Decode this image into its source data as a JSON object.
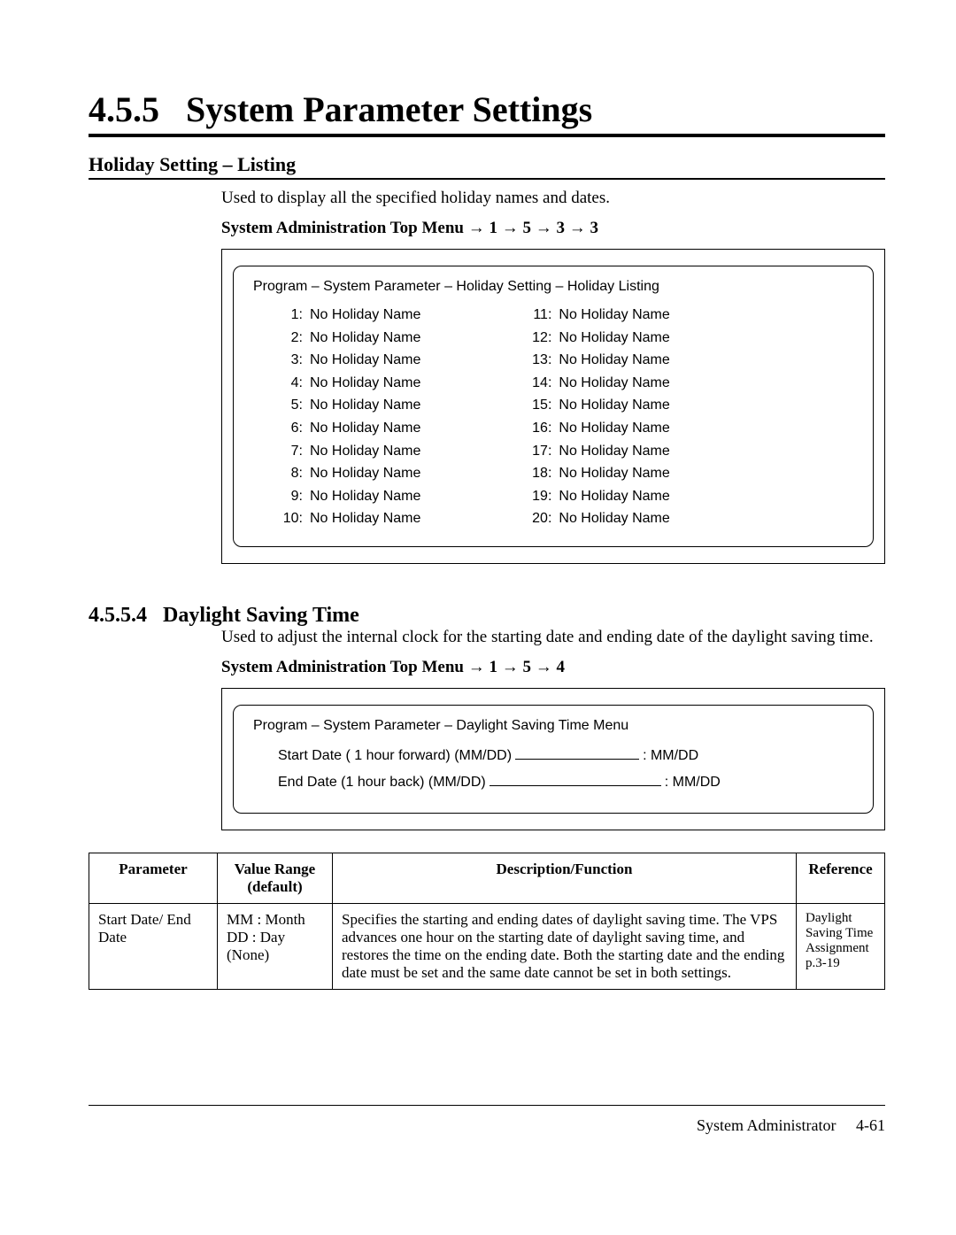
{
  "section": {
    "number": "4.5.5",
    "title": "System Parameter Settings"
  },
  "holiday_listing": {
    "heading": "Holiday Setting – Listing",
    "intro": "Used to display all the specified holiday names and dates.",
    "menu_path": "System Administration Top Menu → 1 → 5 → 3 → 3",
    "screen_title": "Program – System Parameter – Holiday Setting – Holiday Listing",
    "left": [
      {
        "n": "1:",
        "t": "No Holiday Name"
      },
      {
        "n": "2:",
        "t": "No Holiday Name"
      },
      {
        "n": "3:",
        "t": "No Holiday Name"
      },
      {
        "n": "4:",
        "t": "No Holiday Name"
      },
      {
        "n": "5:",
        "t": "No Holiday Name"
      },
      {
        "n": "6:",
        "t": "No Holiday Name"
      },
      {
        "n": "7:",
        "t": "No Holiday Name"
      },
      {
        "n": "8:",
        "t": "No Holiday Name"
      },
      {
        "n": "9:",
        "t": "No Holiday Name"
      },
      {
        "n": "10:",
        "t": "No Holiday Name"
      }
    ],
    "right": [
      {
        "n": "11:",
        "t": "No Holiday Name"
      },
      {
        "n": "12:",
        "t": "No Holiday Name"
      },
      {
        "n": "13:",
        "t": "No Holiday Name"
      },
      {
        "n": "14:",
        "t": "No Holiday Name"
      },
      {
        "n": "15:",
        "t": "No Holiday Name"
      },
      {
        "n": "16:",
        "t": "No Holiday Name"
      },
      {
        "n": "17:",
        "t": "No Holiday Name"
      },
      {
        "n": "18:",
        "t": "No Holiday Name"
      },
      {
        "n": "19:",
        "t": "No Holiday Name"
      },
      {
        "n": "20:",
        "t": "No Holiday Name"
      }
    ]
  },
  "dst": {
    "number": "4.5.5.4",
    "title": "Daylight Saving Time",
    "intro": "Used to adjust the internal clock for the starting date and ending date of the daylight saving time.",
    "menu_path": "System Administration Top Menu → 1 → 5 → 4",
    "screen_title": "Program – System Parameter – Daylight Saving Time Menu",
    "start_label": "Start Date ( 1 hour forward) (MM/DD)",
    "start_value": ":   MM/DD",
    "end_label": "End Date (1 hour back) (MM/DD)",
    "end_value": ":   MM/DD"
  },
  "table": {
    "headers": {
      "c1": "Parameter",
      "c2": "Value Range (default)",
      "c3": "Description/Function",
      "c4": "Reference"
    },
    "row": {
      "c1": "Start Date/ End Date",
      "c2": "MM : Month\nDD  : Day\n(None)",
      "c3": "Specifies the starting and ending dates of daylight saving time.  The VPS advances one hour on the starting date of daylight saving time, and restores the time on the ending date.  Both the starting date and the ending date must be set and the same date cannot be set in both settings.",
      "c4": "Daylight Saving Time Assignment p.3-19"
    }
  },
  "footer": {
    "label": "System Administrator",
    "page": "4-61"
  }
}
